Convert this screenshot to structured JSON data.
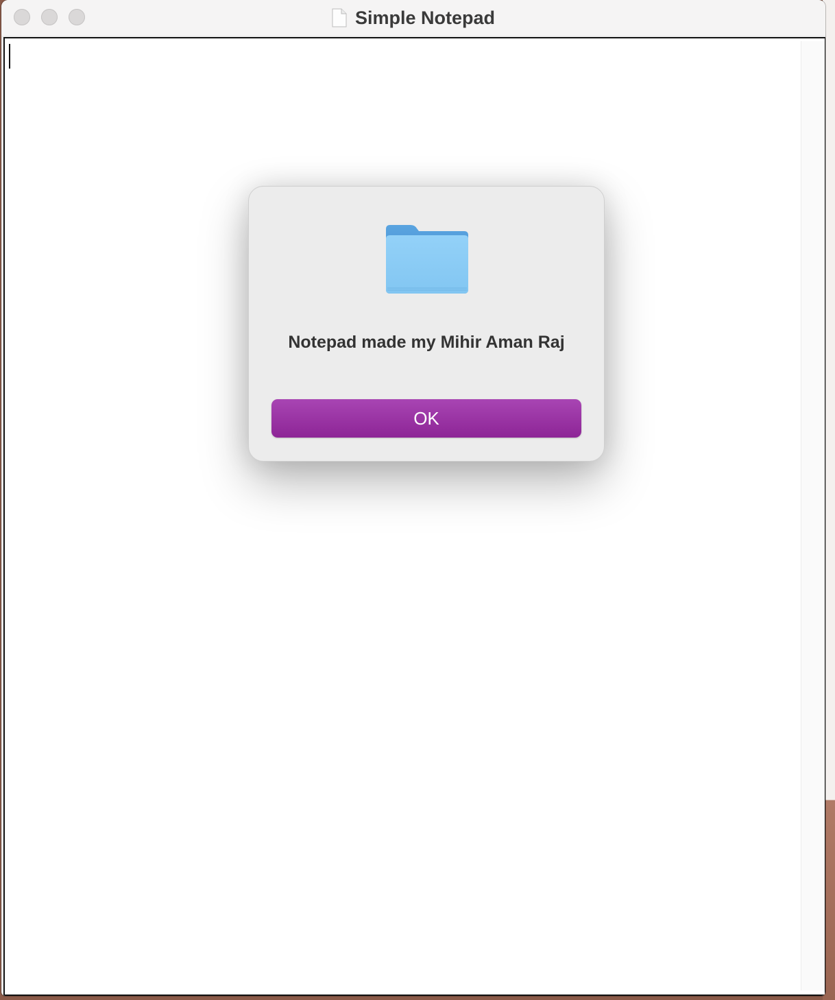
{
  "window": {
    "title": "Simple Notepad",
    "title_icon": "document-icon"
  },
  "editor": {
    "content": ""
  },
  "dialog": {
    "icon": "folder-icon",
    "message": "Notepad made my Mihir Aman Raj",
    "ok_label": "OK",
    "accent_color": "#9b2fa6"
  }
}
